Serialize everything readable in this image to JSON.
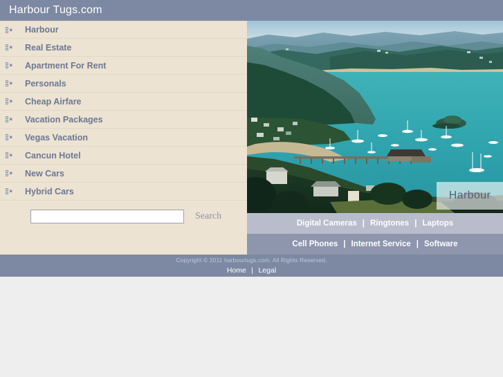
{
  "header": {
    "title": "Harbour Tugs.com",
    "bg_color": "#7d89a3",
    "text_color": "#ffffff"
  },
  "sidebar": {
    "bg_color": "#ece3d3",
    "link_color": "#6d7791",
    "bullet_icon": "three-squares-bullet-icon",
    "items": [
      {
        "label": "Harbour"
      },
      {
        "label": "Real Estate"
      },
      {
        "label": "Apartment For Rent"
      },
      {
        "label": "Personals"
      },
      {
        "label": "Cheap Airfare"
      },
      {
        "label": "Vacation Packages"
      },
      {
        "label": "Vegas Vacation"
      },
      {
        "label": "Cancun Hotel"
      },
      {
        "label": "New Cars"
      },
      {
        "label": "Hybrid Cars"
      }
    ]
  },
  "search": {
    "value": "",
    "placeholder": "",
    "label": "Search"
  },
  "photo": {
    "caption": "Harbour",
    "alt": "Aerial view of a turquoise harbour bay with forested headlands, moored sailboats and a wooden pier"
  },
  "link_bars": [
    {
      "bg_color": "#b8bccb",
      "separator": "|",
      "links": [
        {
          "label": "Digital Cameras"
        },
        {
          "label": "Ringtones"
        },
        {
          "label": "Laptops"
        }
      ]
    },
    {
      "bg_color": "#8e96ad",
      "separator": "|",
      "links": [
        {
          "label": "Cell Phones"
        },
        {
          "label": "Internet Service"
        },
        {
          "label": "Software"
        }
      ]
    }
  ],
  "footer": {
    "bg_color": "#7d89a3",
    "copyright": "Copyright © 2011 harbourtugs.com. All Rights Reserved.",
    "separator": "|",
    "links": [
      {
        "label": "Home"
      },
      {
        "label": "Legal"
      }
    ]
  }
}
